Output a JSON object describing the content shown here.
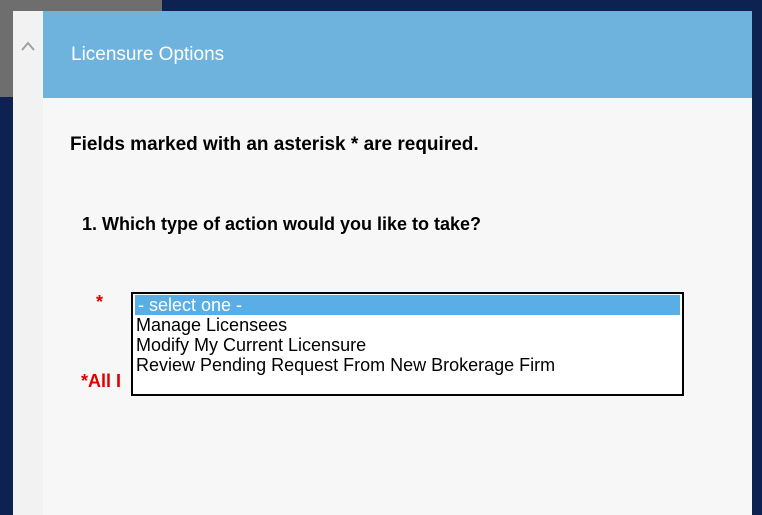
{
  "modal": {
    "title": "Licensure Options",
    "scroll_up_icon": "chevron-up-icon"
  },
  "form": {
    "required_note": "Fields marked with an asterisk * are required.",
    "question": "1. Which type of action would you like to take?",
    "asterisk": "*",
    "all_required_partial": "*All I",
    "action_select": {
      "selected": "- select one -",
      "options": [
        "- select one -",
        "Manage Licensees",
        "Modify My Current Licensure",
        "Review Pending Request From New Brokerage Firm"
      ]
    }
  },
  "colors": {
    "header_bg": "#6db3de",
    "frame": "#0d2250",
    "required_red": "#e00000",
    "selected_option_bg": "#5aaee6"
  }
}
